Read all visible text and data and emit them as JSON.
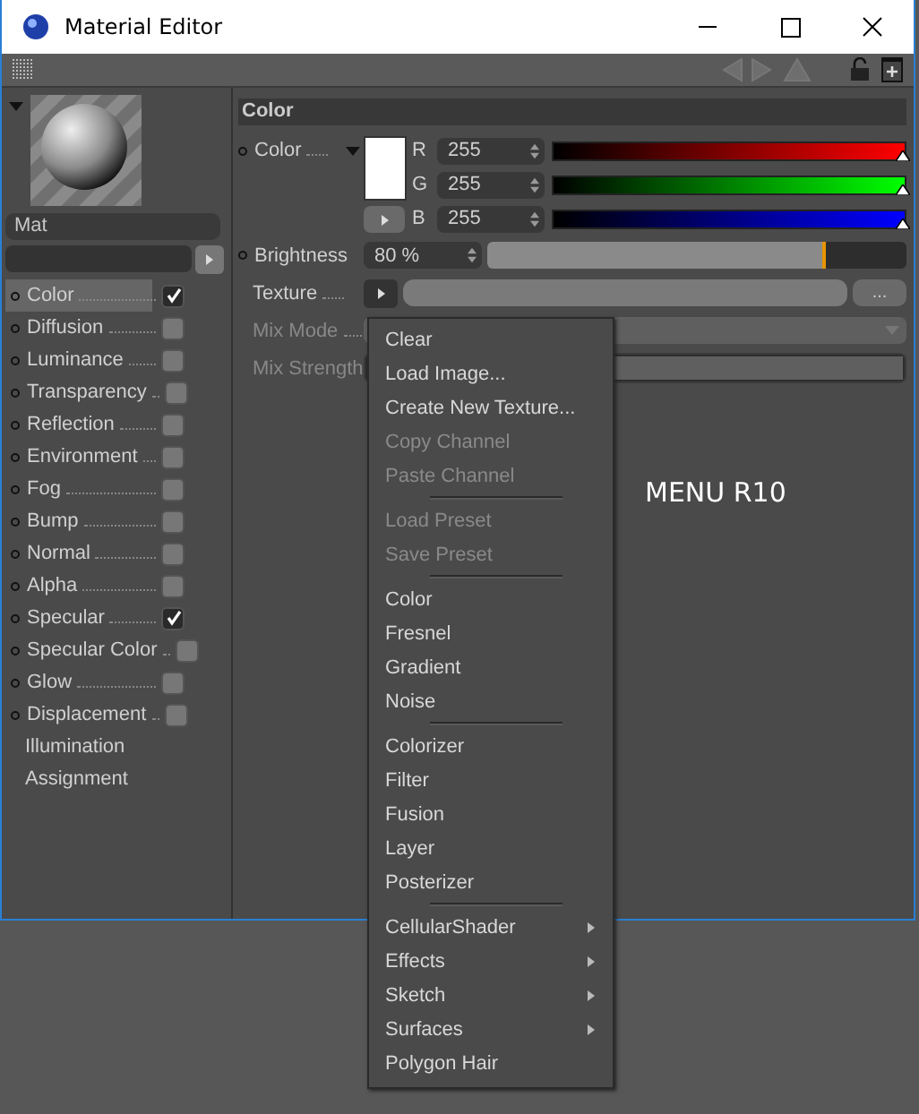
{
  "window": {
    "title": "Material Editor"
  },
  "preview": {
    "name": "Mat"
  },
  "channels": [
    {
      "kind": "channel",
      "label": "Color",
      "checked": true,
      "selected": true
    },
    {
      "kind": "channel",
      "label": "Diffusion",
      "checked": false,
      "selected": false
    },
    {
      "kind": "channel",
      "label": "Luminance",
      "checked": false,
      "selected": false
    },
    {
      "kind": "channel",
      "label": "Transparency",
      "checked": false,
      "selected": false
    },
    {
      "kind": "channel",
      "label": "Reflection",
      "checked": false,
      "selected": false
    },
    {
      "kind": "channel",
      "label": "Environment",
      "checked": false,
      "selected": false
    },
    {
      "kind": "channel",
      "label": "Fog",
      "checked": false,
      "selected": false
    },
    {
      "kind": "channel",
      "label": "Bump",
      "checked": false,
      "selected": false
    },
    {
      "kind": "channel",
      "label": "Normal",
      "checked": false,
      "selected": false
    },
    {
      "kind": "channel",
      "label": "Alpha",
      "checked": false,
      "selected": false
    },
    {
      "kind": "channel",
      "label": "Specular",
      "checked": true,
      "selected": false
    },
    {
      "kind": "channel",
      "label": "Specular Color",
      "checked": false,
      "selected": false
    },
    {
      "kind": "channel",
      "label": "Glow",
      "checked": false,
      "selected": false
    },
    {
      "kind": "channel",
      "label": "Displacement",
      "checked": false,
      "selected": false
    },
    {
      "kind": "section",
      "label": "Illumination",
      "selected": false
    },
    {
      "kind": "section",
      "label": "Assignment",
      "selected": false
    }
  ],
  "section_title": "Color",
  "color_param": {
    "label": "Color",
    "components": [
      {
        "label": "R",
        "value": "255",
        "level": 1
      },
      {
        "label": "G",
        "value": "255",
        "level": 1
      },
      {
        "label": "B",
        "value": "255",
        "level": 1
      }
    ]
  },
  "brightness": {
    "label": "Brightness",
    "value": "80 %",
    "level": 0.8
  },
  "texture": {
    "label": "Texture",
    "browse": "..."
  },
  "mix_mode": {
    "label": "Mix Mode",
    "disabled": true
  },
  "mix_strength": {
    "label": "Mix Strength",
    "disabled": true,
    "level": 1
  },
  "menu": [
    {
      "kind": "item",
      "label": "Clear",
      "disabled": false,
      "submenu": false
    },
    {
      "kind": "item",
      "label": "Load Image...",
      "disabled": false,
      "submenu": false
    },
    {
      "kind": "item",
      "label": "Create New Texture...",
      "disabled": false,
      "submenu": false
    },
    {
      "kind": "item",
      "label": "Copy Channel",
      "disabled": true,
      "submenu": false
    },
    {
      "kind": "item",
      "label": "Paste Channel",
      "disabled": true,
      "submenu": false
    },
    {
      "kind": "separator"
    },
    {
      "kind": "item",
      "label": "Load Preset",
      "disabled": true,
      "submenu": false
    },
    {
      "kind": "item",
      "label": "Save Preset",
      "disabled": true,
      "submenu": false
    },
    {
      "kind": "separator"
    },
    {
      "kind": "item",
      "label": "Color",
      "disabled": false,
      "submenu": false
    },
    {
      "kind": "item",
      "label": "Fresnel",
      "disabled": false,
      "submenu": false
    },
    {
      "kind": "item",
      "label": "Gradient",
      "disabled": false,
      "submenu": false
    },
    {
      "kind": "item",
      "label": "Noise",
      "disabled": false,
      "submenu": false
    },
    {
      "kind": "separator"
    },
    {
      "kind": "item",
      "label": "Colorizer",
      "disabled": false,
      "submenu": false
    },
    {
      "kind": "item",
      "label": "Filter",
      "disabled": false,
      "submenu": false
    },
    {
      "kind": "item",
      "label": "Fusion",
      "disabled": false,
      "submenu": false
    },
    {
      "kind": "item",
      "label": "Layer",
      "disabled": false,
      "submenu": false
    },
    {
      "kind": "item",
      "label": "Posterizer",
      "disabled": false,
      "submenu": false
    },
    {
      "kind": "separator"
    },
    {
      "kind": "item",
      "label": "CellularShader",
      "disabled": false,
      "submenu": true
    },
    {
      "kind": "item",
      "label": "Effects",
      "disabled": false,
      "submenu": true
    },
    {
      "kind": "item",
      "label": "Sketch",
      "disabled": false,
      "submenu": true
    },
    {
      "kind": "item",
      "label": "Surfaces",
      "disabled": false,
      "submenu": true
    },
    {
      "kind": "item",
      "label": "Polygon Hair",
      "disabled": false,
      "submenu": false
    }
  ],
  "annotation": "MENU R10"
}
